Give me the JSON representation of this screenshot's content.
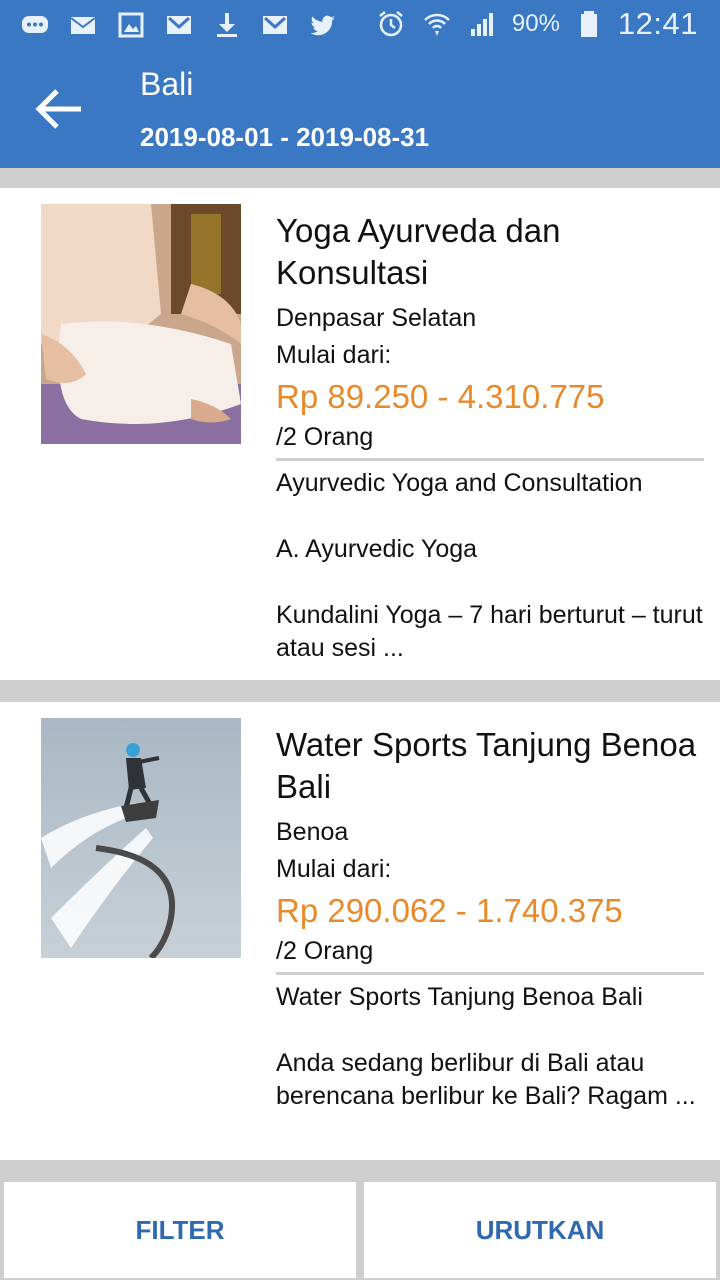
{
  "status_bar": {
    "battery_percent": "90%",
    "time": "12:41",
    "left_icons": [
      "messages-icon",
      "mail-icon",
      "gallery-icon",
      "gmail-icon",
      "download-icon",
      "gmail-icon",
      "twitter-icon"
    ],
    "right_icons": [
      "alarm-icon",
      "wifi-icon",
      "signal-icon",
      "battery-icon"
    ]
  },
  "header": {
    "title": "Bali",
    "date_range": "2019-08-01  -  2019-08-31",
    "back_icon": "arrow-left-icon"
  },
  "listings": [
    {
      "title": "Yoga Ayurveda dan Konsultasi",
      "location": "Denpasar Selatan",
      "from_label": "Mulai dari:",
      "price": "Rp 89.250 - 4.310.775",
      "per": "/2 Orang",
      "description": "Ayurvedic Yoga and Consultation\n\nA. Ayurvedic Yoga\n\nKundalini Yoga – 7 hari berturut – turut atau sesi ..."
    },
    {
      "title": "Water Sports Tanjung Benoa Bali",
      "location": "Benoa",
      "from_label": "Mulai dari:",
      "price": "Rp 290.062 - 1.740.375",
      "per": "/2 Orang",
      "description": "Water Sports Tanjung Benoa Bali\n\nAnda sedang berlibur di Bali atau berencana berlibur ke  Bali? Ragam ..."
    }
  ],
  "bottom_bar": {
    "filter_label": "FILTER",
    "sort_label": "URUTKAN"
  },
  "colors": {
    "header_blue": "#3a78c3",
    "price_orange": "#e8892b",
    "button_blue": "#2f69b0"
  }
}
